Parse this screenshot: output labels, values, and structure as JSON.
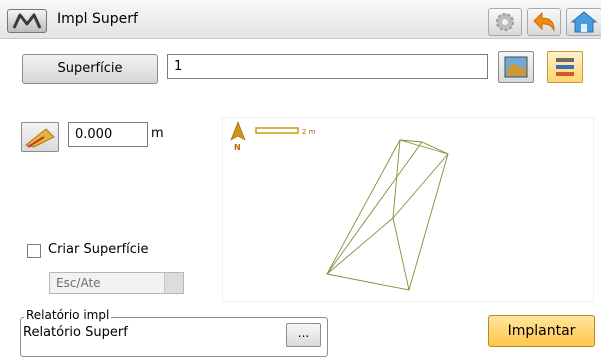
{
  "window": {
    "title": "Impl Superf"
  },
  "toolbar": {
    "settings_icon": "gear-icon",
    "back_icon": "return-arrow-icon",
    "home_icon": "home-icon"
  },
  "surface": {
    "button_label": "Superfície",
    "value": "1",
    "map_icon": "map-icon",
    "layers_icon": "layers-list-icon"
  },
  "offset": {
    "value": "0.000",
    "unit": "m",
    "icon": "ruler-icon"
  },
  "map": {
    "north_label": "N",
    "scale_label": "2 m",
    "colors": {
      "surface_lines": "#8a8a3a",
      "north_arrow": "#d49516"
    }
  },
  "create_surface": {
    "label": "Criar Superfície",
    "checked": false,
    "select_value": "Esc/Ate"
  },
  "report": {
    "legend": "Relatório impl",
    "value": "Relatório Superf",
    "browse_label": "..."
  },
  "actions": {
    "stake_label": "Implantar"
  }
}
